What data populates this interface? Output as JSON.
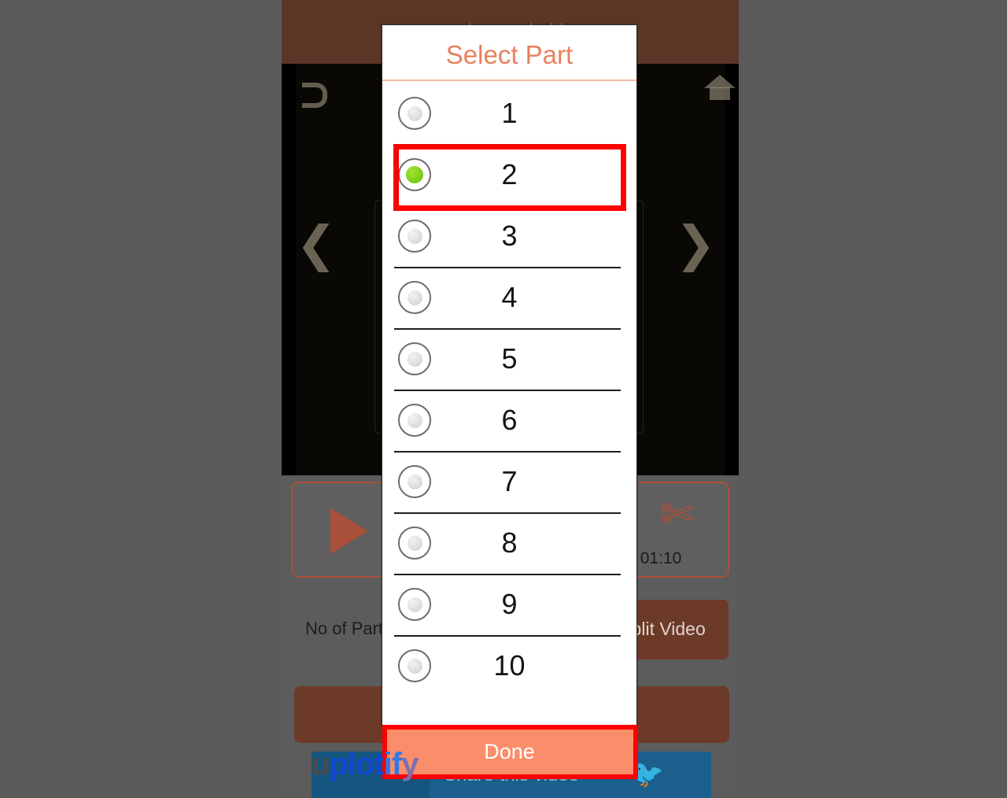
{
  "app": {
    "header_title": "Background Video",
    "video_time": "01:10",
    "no_of_parts_label": "No of Parts",
    "split_video_label": "Split Video",
    "social_text": "Share this video",
    "watermark": {
      "part1": "u",
      "part2": "plot",
      "part3": "if",
      "part4": "y"
    },
    "icons": {
      "play": "play-icon",
      "scissors": "✄",
      "twitter": "🐦",
      "home": "home-icon",
      "back": "back-icon"
    }
  },
  "dialog": {
    "title": "Select Part",
    "done_label": "Done",
    "selected_value": "2",
    "options": [
      {
        "label": "1",
        "selected": false
      },
      {
        "label": "2",
        "selected": true
      },
      {
        "label": "3",
        "selected": false
      },
      {
        "label": "4",
        "selected": false
      },
      {
        "label": "5",
        "selected": false
      },
      {
        "label": "6",
        "selected": false
      },
      {
        "label": "7",
        "selected": false
      },
      {
        "label": "8",
        "selected": false
      },
      {
        "label": "9",
        "selected": false
      },
      {
        "label": "10",
        "selected": false
      }
    ]
  },
  "colors": {
    "backdrop": "#5a5a5a",
    "app_header": "#5c3526",
    "accent_coral": "#e8805d",
    "done_button": "#fb8e6a",
    "annotation_red": "#fe0000",
    "radio_selected_green": "#76cc18",
    "brown_button": "#6d3a28",
    "control_outline": "#a8503a",
    "social_blue": "#1b5f8c"
  }
}
